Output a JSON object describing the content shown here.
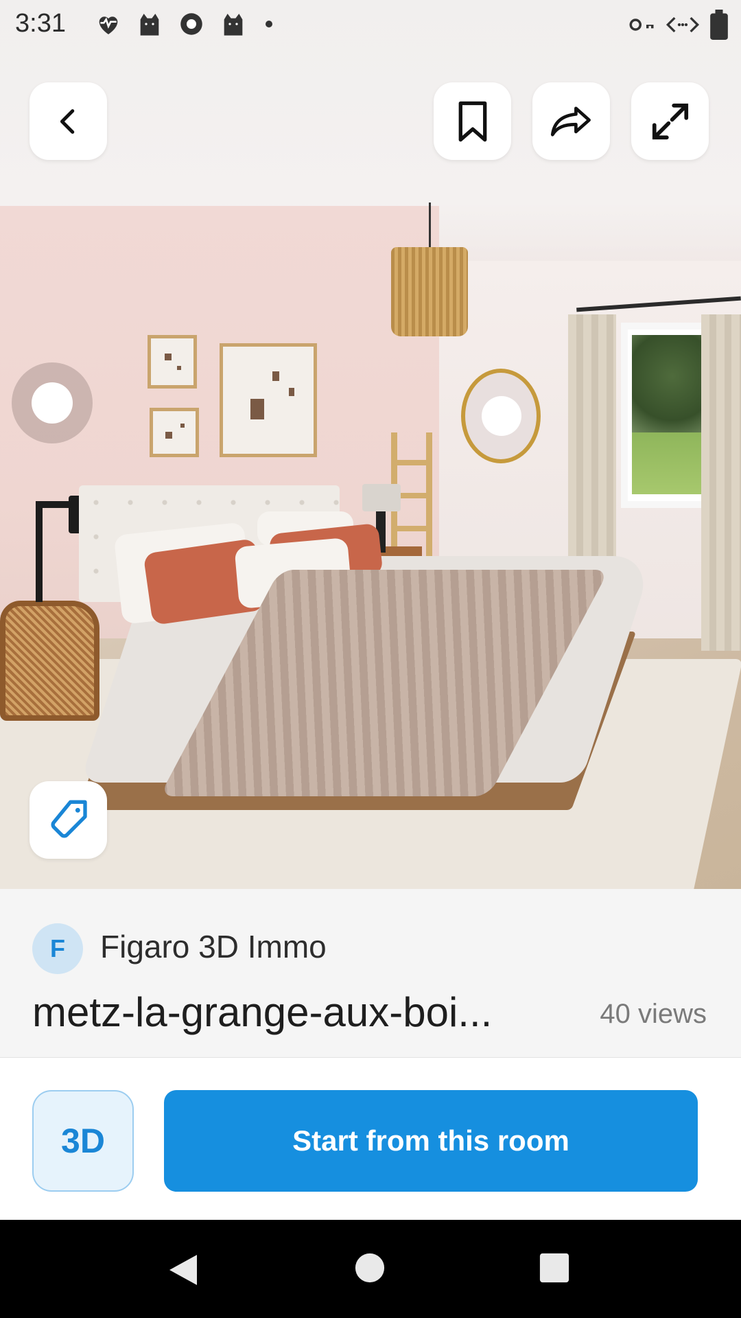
{
  "status_bar": {
    "time": "3:31",
    "left_icons": [
      "heart-monitor-icon",
      "cat-icon",
      "gear-badge-icon",
      "cat-icon",
      "dot-icon"
    ],
    "right_icons": [
      "key-icon",
      "data-saver-icon",
      "battery-icon"
    ]
  },
  "top_buttons": {
    "back": "back-icon",
    "bookmark": "bookmark-icon",
    "share": "share-icon",
    "fullscreen": "expand-icon"
  },
  "tag_button": "tag-icon",
  "info": {
    "avatar_letter": "F",
    "author": "Figaro 3D Immo",
    "title": "metz-la-grange-aux-boi...",
    "views": "40 views"
  },
  "actions": {
    "three_d_label": "3D",
    "start_label": "Start from this room"
  },
  "nav": {
    "back": "nav-back-icon",
    "home": "nav-home-icon",
    "recents": "nav-recents-icon"
  },
  "colors": {
    "accent": "#168fdf",
    "accent_light": "#e6f3fc",
    "navbar": "#000000"
  }
}
